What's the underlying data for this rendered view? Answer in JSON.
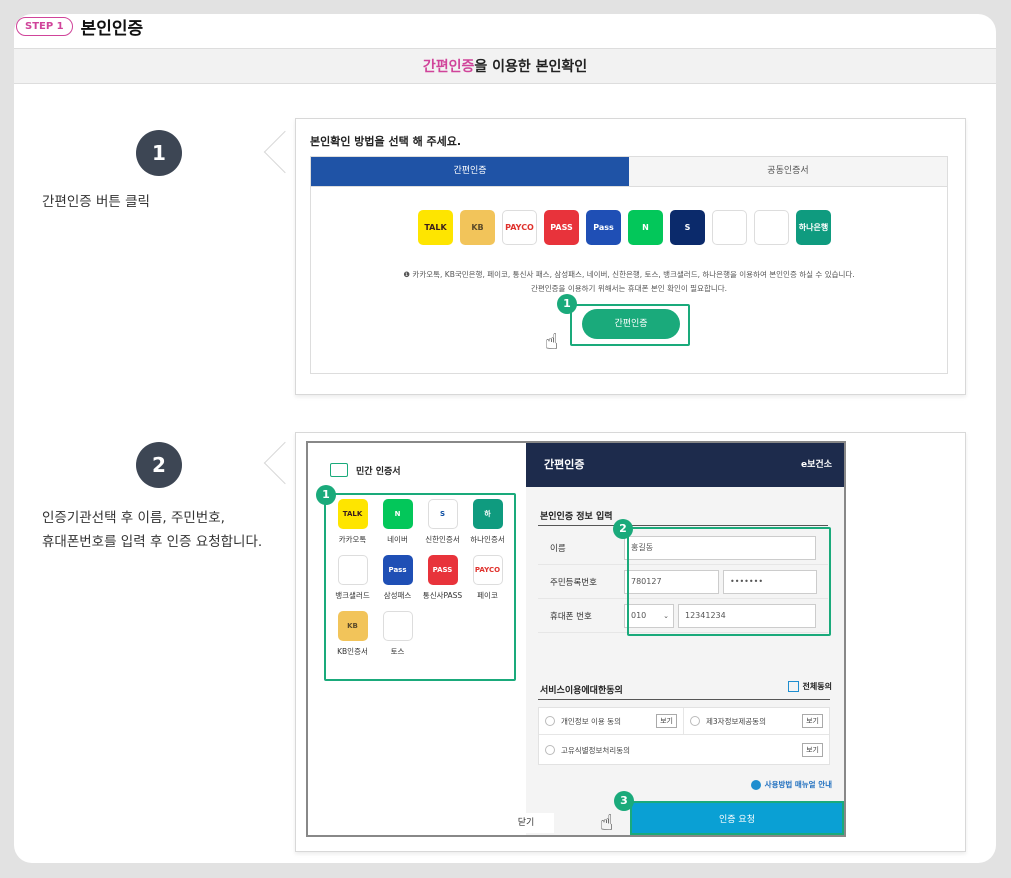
{
  "step": {
    "badge": "STEP 1",
    "title": "본인인증"
  },
  "banner": {
    "highlight": "간편인증",
    "rest": "을 이용한 본인확인"
  },
  "steps": [
    {
      "number": "1",
      "desc": "간편인증 버튼 클릭"
    },
    {
      "number": "2",
      "desc_line1": "인증기관선택 후 이름, 주민번호,",
      "desc_line2": "휴대폰번호를 입력 후 인증 요청합니다."
    }
  ],
  "panel1": {
    "title": "본인확인 방법을 선택 해 주세요.",
    "tabs": [
      "간편인증",
      "공동인증서"
    ],
    "active_tab": "간편인증",
    "providers": [
      {
        "name": "kakao",
        "label": "TALK",
        "bg": "#fee500",
        "fg": "#3a1d1d"
      },
      {
        "name": "kb",
        "label": "KB",
        "bg": "#f2c45a",
        "fg": "#5a4a2a"
      },
      {
        "name": "payco",
        "label": "PAYCO",
        "bg": "#ffffff",
        "fg": "#e0322d"
      },
      {
        "name": "pass",
        "label": "PASS",
        "bg": "#e8333b",
        "fg": "#ffffff"
      },
      {
        "name": "samsung-pass",
        "label": "Pass",
        "bg": "#1f4fb5",
        "fg": "#ffffff"
      },
      {
        "name": "naver",
        "label": "N",
        "bg": "#03c75a",
        "fg": "#ffffff"
      },
      {
        "name": "shinhan",
        "label": "S",
        "bg": "#0b2a6b",
        "fg": "#ffffff"
      },
      {
        "name": "toss",
        "label": "",
        "bg": "#ffffff",
        "fg": "#1b64da"
      },
      {
        "name": "banksalad",
        "label": "",
        "bg": "#ffffff",
        "fg": "#26c3a0"
      },
      {
        "name": "hana",
        "label": "하나은행",
        "bg": "#0f9b7f",
        "fg": "#ffffff"
      }
    ],
    "notice1": "❶ 카카오톡, KB국민은행, 페이코, 통신사 패스, 삼성패스, 네이버, 신한은행, 토스, 뱅크샐러드, 하나은행을 이용하여 본인인증 하실 수 있습니다.",
    "notice2": "간편인증을 이용하기 위해서는 휴대폰 본인 확인이 필요합니다.",
    "button": "간편인증",
    "callout": "1"
  },
  "panel2": {
    "left_title": "민간 인증서",
    "apps": [
      {
        "name": "kakao",
        "icon": "TALK",
        "label": "카카오톡",
        "bg": "#fee500",
        "fg": "#3a1d1d"
      },
      {
        "name": "naver",
        "icon": "N",
        "label": "네이버",
        "bg": "#03c75a",
        "fg": "#ffffff"
      },
      {
        "name": "shinhan",
        "icon": "S",
        "label": "신한인증서",
        "bg": "#ffffff",
        "fg": "#0b4da2"
      },
      {
        "name": "hana",
        "icon": "하",
        "label": "하나인증서",
        "bg": "#0f9b7f",
        "fg": "#ffffff"
      },
      {
        "name": "banksalad",
        "icon": "",
        "label": "뱅크샐러드",
        "bg": "#ffffff",
        "fg": "#26c3a0"
      },
      {
        "name": "samsung-pass",
        "icon": "Pass",
        "label": "삼성패스",
        "bg": "#1f4fb5",
        "fg": "#ffffff"
      },
      {
        "name": "pass",
        "icon": "PASS",
        "label": "통신사PASS",
        "bg": "#e8333b",
        "fg": "#ffffff"
      },
      {
        "name": "payco",
        "icon": "PAYCO",
        "label": "페이코",
        "bg": "#ffffff",
        "fg": "#e0322d"
      },
      {
        "name": "kb",
        "icon": "KB",
        "label": "KB인증서",
        "bg": "#f2c45a",
        "fg": "#5a4a2a"
      },
      {
        "name": "toss",
        "icon": "",
        "label": "토스",
        "bg": "#ffffff",
        "fg": "#1b64da"
      }
    ],
    "header": "간편인증",
    "logo": "e보건소",
    "form_title": "본인인증 정보 입력",
    "name_label": "이름",
    "name_value": "홍길동",
    "rrn_label": "주민등록번호",
    "rrn_front": "780127",
    "rrn_back": "•••••••",
    "phone_label": "휴대폰 번호",
    "phone_prefix": "010",
    "phone_number": "12341234",
    "agree_title": "서비스이용에대한동의",
    "agree_all": "전체동의",
    "agree_items": [
      "개인정보 이용 동의",
      "제3자정보제공동의",
      "고유식별정보처리동의"
    ],
    "view_label": "보기",
    "manual": "사용방법 매뉴얼 안내",
    "close": "닫기",
    "request": "인증 요청",
    "callouts": [
      "1",
      "2",
      "3"
    ]
  },
  "colors": {
    "accent": "#d0449a",
    "green": "#1aaa7b",
    "blue": "#1f53a6",
    "request": "#0aa0d4"
  }
}
